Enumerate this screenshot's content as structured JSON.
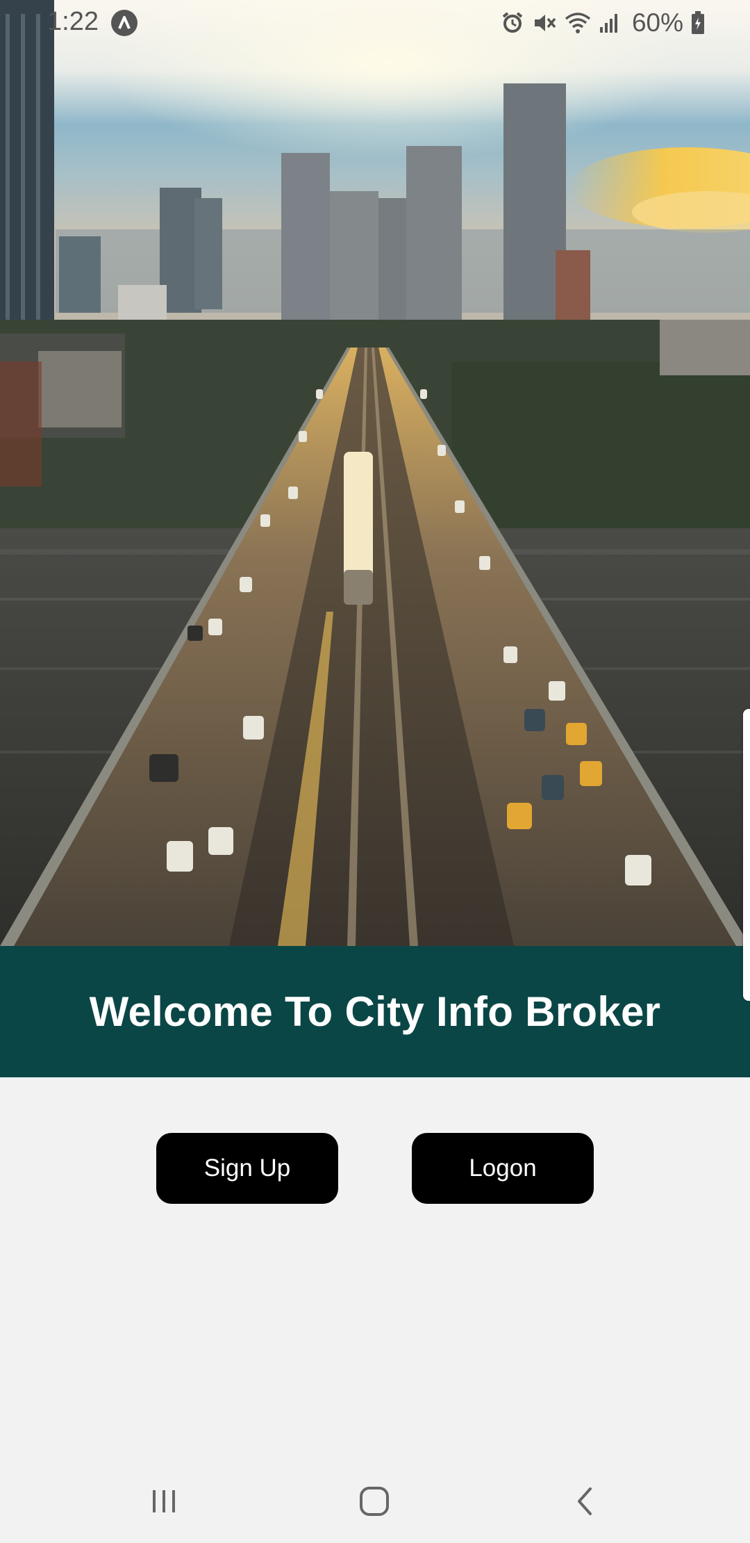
{
  "status_bar": {
    "time": "1:22",
    "battery": "60%",
    "icons": [
      "app-notification-icon",
      "alarm-icon",
      "mute-icon",
      "wifi-icon",
      "signal-icon",
      "battery-charging-icon"
    ]
  },
  "hero": {
    "image": "city-bridge-traffic-image"
  },
  "banner": {
    "title": "Welcome To City Info Broker",
    "background_color": "#0b4646"
  },
  "buttons": {
    "signup_label": "Sign Up",
    "logon_label": "Logon"
  },
  "nav_bar": {
    "buttons": [
      "recents-icon",
      "home-icon",
      "back-icon"
    ]
  },
  "colors": {
    "button_bg": "#000000",
    "button_text": "#ffffff",
    "page_bg": "#f2f2f2"
  }
}
